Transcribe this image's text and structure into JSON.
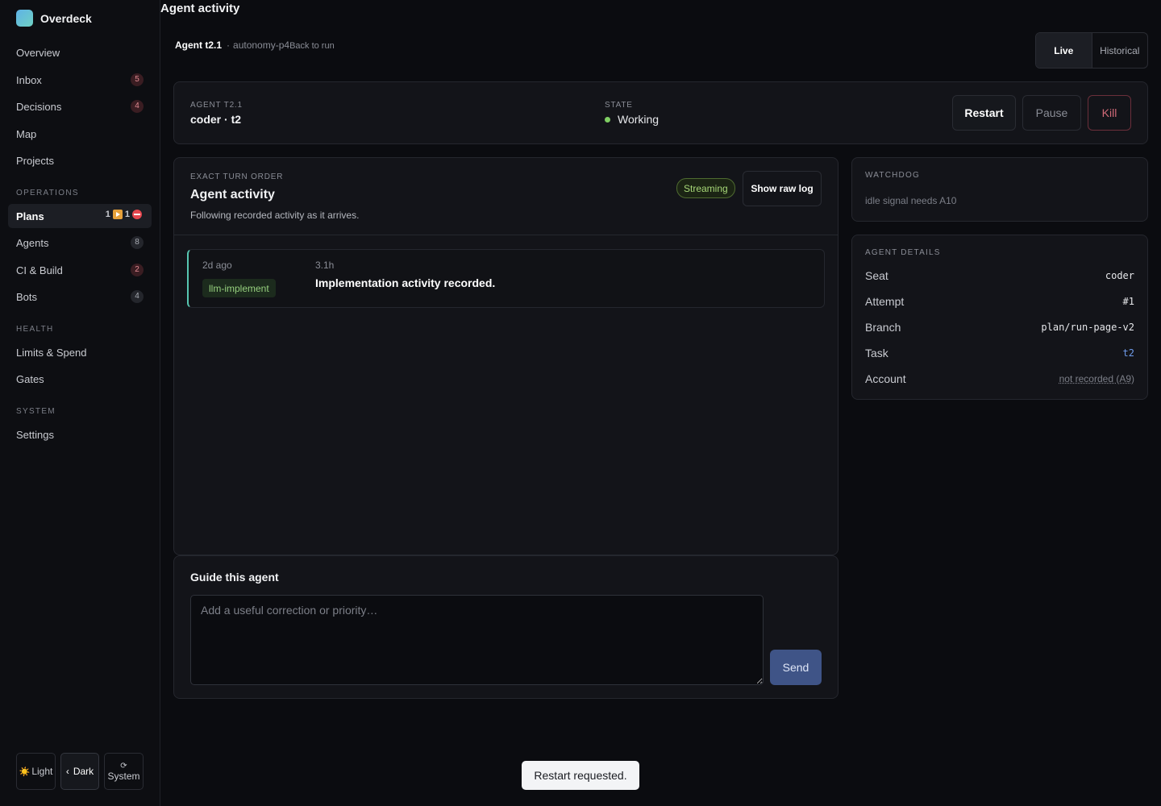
{
  "brand": {
    "name": "Overdeck"
  },
  "sidebar": {
    "items": [
      {
        "label": "Overview"
      },
      {
        "label": "Inbox",
        "badge": "5"
      },
      {
        "label": "Decisions",
        "badge": "4"
      },
      {
        "label": "Map"
      },
      {
        "label": "Projects"
      }
    ],
    "operations_label": "OPERATIONS",
    "operations": [
      {
        "label": "Plans",
        "running": "1",
        "blocked": "1"
      },
      {
        "label": "Agents",
        "badge": "8"
      },
      {
        "label": "CI & Build",
        "badge": "2"
      },
      {
        "label": "Bots",
        "badge": "4"
      }
    ],
    "health_label": "HEALTH",
    "health": [
      {
        "label": "Limits & Spend"
      },
      {
        "label": "Gates"
      }
    ],
    "system_label": "SYSTEM",
    "system": [
      {
        "label": "Settings"
      }
    ],
    "theme": {
      "light": "Light",
      "light_icon": "☀️",
      "dark": "Dark",
      "dark_icon": "‹",
      "system": "System",
      "system_icon": "⟳"
    }
  },
  "header": {
    "title": "Agent activity",
    "agent": "Agent t2.1",
    "separator": "·",
    "plan": "autonomy-p4",
    "back": "Back to run",
    "modes": [
      "Live",
      "Historical"
    ]
  },
  "summary": {
    "agent_label": "AGENT T2.1",
    "agent_value": "coder · t2",
    "state_label": "STATE",
    "state_value": "Working",
    "state_color": "#7fce63",
    "restart": "Restart",
    "pause": "Pause",
    "kill": "Kill"
  },
  "activity": {
    "eyebrow": "EXACT TURN ORDER",
    "title": "Agent activity",
    "subtitle": "Following recorded activity as it arrives.",
    "status": "Streaming",
    "raw_log": "Show raw log",
    "events": [
      {
        "ago": "2d ago",
        "tag": "llm-implement",
        "duration": "3.1h",
        "text": "Implementation activity recorded."
      }
    ]
  },
  "guide": {
    "title": "Guide this agent",
    "placeholder": "Add a useful correction or priority…",
    "send": "Send"
  },
  "watchdog": {
    "label": "WATCHDOG",
    "text": "idle signal needs A10"
  },
  "details": {
    "label": "AGENT DETAILS",
    "rows": [
      {
        "key": "Seat",
        "value": "coder"
      },
      {
        "key": "Attempt",
        "value": "#1"
      },
      {
        "key": "Branch",
        "value": "plan/run-page-v2"
      },
      {
        "key": "Task",
        "value": "t2"
      },
      {
        "key": "Account",
        "value": "not recorded (A9)"
      }
    ]
  },
  "toast": {
    "text": "Restart requested."
  }
}
